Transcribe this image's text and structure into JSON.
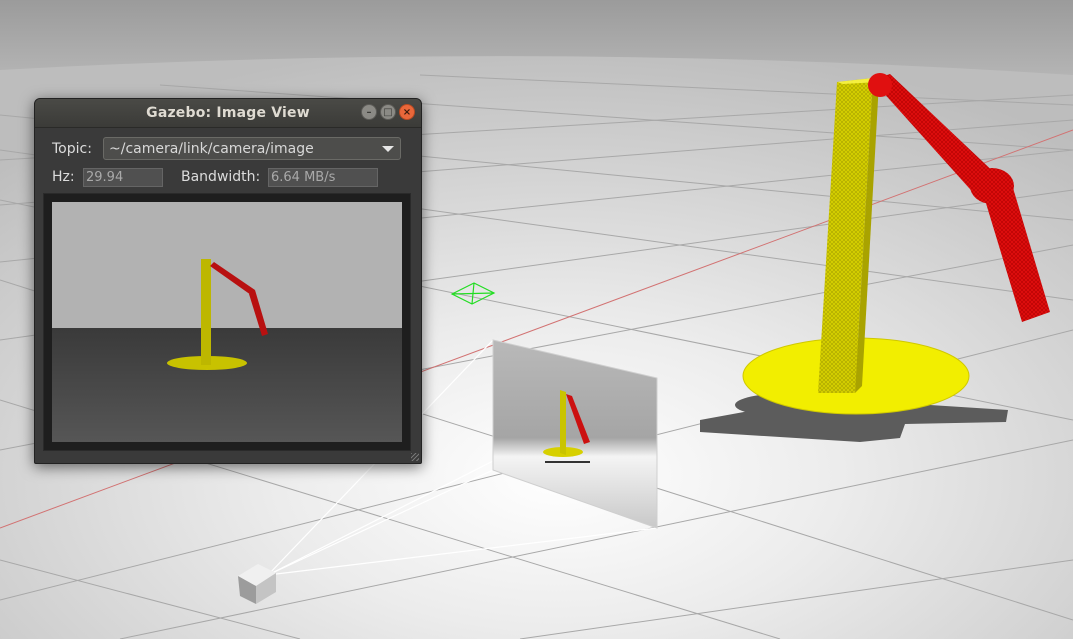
{
  "window": {
    "title": "Gazebo: Image View",
    "topic_label": "Topic:",
    "topic_value": "~/camera/link/camera/image",
    "hz_label": "Hz:",
    "hz_value": "29.94",
    "bandwidth_label": "Bandwidth:",
    "bandwidth_value": "6.64 MB/s"
  },
  "icons": {
    "minimize": "minimize-icon",
    "maximize": "maximize-icon",
    "close": "close-icon",
    "dropdown": "chevron-down-icon"
  },
  "colors": {
    "arm_red": "#e01010",
    "column_yellow": "#c9c400",
    "base_yellow": "#f2ee00",
    "ground": "#cfcfcf",
    "axis_red": "#e07070",
    "camera_frustum_green": "#22dd22"
  }
}
